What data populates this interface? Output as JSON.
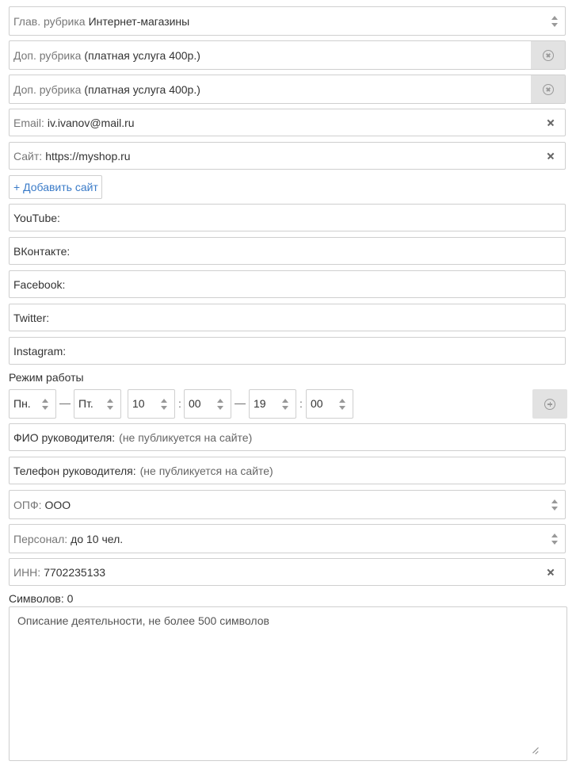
{
  "main_rubric": {
    "label": "Глав. рубрика",
    "value": "Интернет-магазины"
  },
  "extra_rubric_1": {
    "label": "Доп. рубрика",
    "hint": "(платная услуга 400р.)"
  },
  "extra_rubric_2": {
    "label": "Доп. рубрика",
    "hint": "(платная услуга 400р.)"
  },
  "email": {
    "label": "Email:",
    "value": "iv.ivanov@mail.ru"
  },
  "site": {
    "label": "Сайт:",
    "value": "https://myshop.ru"
  },
  "add_site_label": "+ Добавить сайт",
  "socials": {
    "youtube": "YouTube:",
    "vk": "ВКонтакте:",
    "facebook": "Facebook:",
    "twitter": "Twitter:",
    "instagram": "Instagram:"
  },
  "schedule": {
    "title": "Режим работы",
    "day_from": "Пн.",
    "day_to": "Пт.",
    "hour_from": "10",
    "min_from": "00",
    "hour_to": "19",
    "min_to": "00",
    "dash": "—",
    "colon": ":"
  },
  "director_name": {
    "label": "ФИО руководителя:",
    "placeholder": "(не публикуется на сайте)"
  },
  "director_phone": {
    "label": "Телефон руководителя:",
    "placeholder": "(не публикуется на сайте)"
  },
  "opf": {
    "label": "ОПФ:",
    "value": "ООО"
  },
  "staff": {
    "label": "Персонал:",
    "value": "до 10 чел."
  },
  "inn": {
    "label": "ИНН:",
    "value": "7702235133"
  },
  "symbols": {
    "label": "Символов:",
    "count": "0"
  },
  "description": {
    "placeholder": "Описание деятельности, не более 500 символов"
  },
  "colors": {
    "link": "#3a7bc8",
    "border": "#cfcfcf",
    "side_button": "#e2e2e2"
  }
}
